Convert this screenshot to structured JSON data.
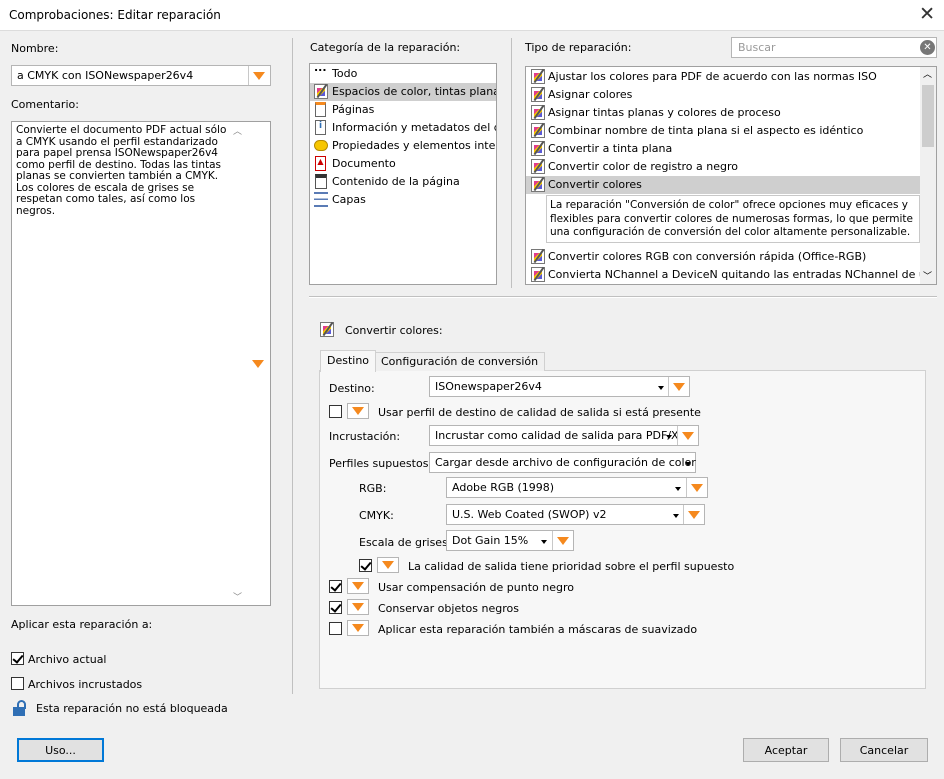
{
  "window": {
    "title": "Comprobaciones: Editar reparación",
    "close_glyph": "✕"
  },
  "left": {
    "name_label": "Nombre:",
    "name_value": "a CMYK con ISONewspaper26v4",
    "comment_label": "Comentario:",
    "comment_text": "Convierte el documento PDF actual sólo a CMYK usando el perfil estandarizado para papel prensa ISONewspaper26v4 como perfil de destino. Todas las tintas planas se convierten también a CMYK. Los colores de escala de grises se respetan como tales, así como los negros.",
    "apply_label": "Aplicar esta reparación a:",
    "current_file": {
      "label": "Archivo actual",
      "checked": true
    },
    "embedded_files": {
      "label": "Archivos incrustados",
      "checked": false
    },
    "lock_status": "Esta reparación no está bloqueada",
    "uso_button": "Uso..."
  },
  "category": {
    "label": "Categoría de la reparación:",
    "items": [
      {
        "label": "Todo",
        "icon": "dots-icon"
      },
      {
        "label": "Espacios de color, tintas planas, superposición",
        "icon": "color-wand-icon",
        "selected": true
      },
      {
        "label": "Páginas",
        "icon": "page-icon"
      },
      {
        "label": "Información y metadatos del documento",
        "icon": "info-icon"
      },
      {
        "label": "Propiedades y elementos interactivos",
        "icon": "comment-icon"
      },
      {
        "label": "Documento",
        "icon": "pdf-icon"
      },
      {
        "label": "Contenido de la página",
        "icon": "content-icon"
      },
      {
        "label": "Capas",
        "icon": "layers-icon"
      }
    ]
  },
  "fixup_type": {
    "label": "Tipo de reparación:",
    "search_placeholder": "Buscar",
    "items": [
      "Ajustar los colores para PDF de acuerdo con las normas ISO",
      "Asignar colores",
      "Asignar tintas planas y colores de proceso",
      "Combinar nombre de tinta plana si el aspecto es idéntico",
      "Convertir a tinta plana",
      "Convertir color de registro a negro",
      "Convertir colores",
      "Convertir colores RGB con conversión rápida (Office-RGB)",
      "Convierta NChannel a DeviceN quitando las entradas NChannel de un espacio de color"
    ],
    "selected_index": 6,
    "description": "La reparación \"Conversión de color\" ofrece opciones muy eficaces y flexibles para convertir colores de numerosas formas, lo que permite una configuración de conversión del color altamente personalizable."
  },
  "settings": {
    "header": "Convertir colores:",
    "tabs": [
      "Destino",
      "Configuración de conversión"
    ],
    "active_tab": 0,
    "destination_label": "Destino:",
    "destination_value": "ISOnewspaper26v4",
    "use_output_intent": {
      "label": "Usar perfil de destino de calidad de salida si está presente",
      "checked": false
    },
    "embed_label": "Incrustación:",
    "embed_value": "Incrustar como calidad de salida para PDF/X",
    "assumed_label": "Perfiles supuestos:",
    "assumed_value": "Cargar desde archivo de configuración de color",
    "rgb_label": "RGB:",
    "rgb_value": "Adobe RGB (1998)",
    "cmyk_label": "CMYK:",
    "cmyk_value": "U.S. Web Coated (SWOP) v2",
    "gray_label": "Escala de grises:",
    "gray_value": "Dot Gain 15%",
    "output_priority": {
      "label": "La calidad de salida tiene prioridad sobre el perfil supuesto",
      "checked": true
    },
    "bpc": {
      "label": "Usar compensación de punto negro",
      "checked": true
    },
    "keep_black": {
      "label": "Conservar objetos negros",
      "checked": true
    },
    "soft_masks": {
      "label": "Aplicar esta reparación también a máscaras de suavizado",
      "checked": false
    }
  },
  "footer": {
    "ok": "Aceptar",
    "cancel": "Cancelar"
  }
}
